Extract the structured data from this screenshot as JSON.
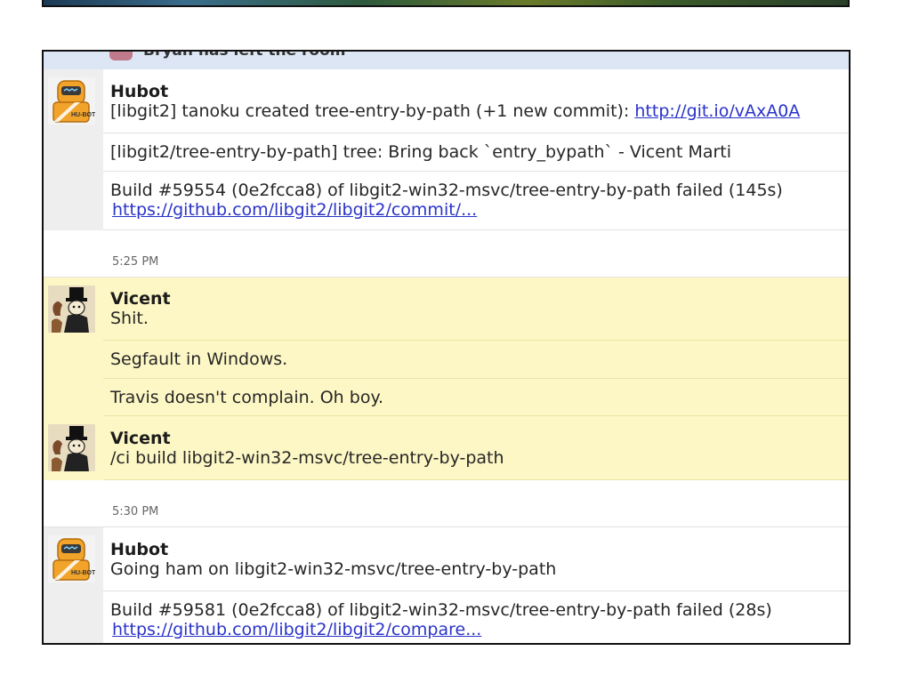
{
  "system_notice": "Bryan has left the room",
  "feed": [
    {
      "author": "Hubot",
      "messages": [
        {
          "text": "[libgit2] tanoku created tree-entry-by-path (+1 new commit): ",
          "link": "http://git.io/vAxA0A"
        },
        {
          "text": "[libgit2/tree-entry-by-path] tree: Bring back `entry_bypath` - Vicent Marti"
        },
        {
          "text": "Build #59554 (0e2fcca8) of libgit2-win32-msvc/tree-entry-by-path failed (145s)",
          "link": "https://github.com/libgit2/libgit2/commit/..."
        }
      ]
    },
    {
      "timestamp": "5:25 PM"
    },
    {
      "author": "Vicent",
      "messages": [
        {
          "text": "Shit."
        },
        {
          "text": "Segfault in Windows."
        },
        {
          "text": "Travis doesn't complain. Oh boy."
        }
      ]
    },
    {
      "author": "Vicent",
      "messages": [
        {
          "text": "/ci build libgit2-win32-msvc/tree-entry-by-path"
        }
      ]
    },
    {
      "timestamp": "5:30 PM"
    },
    {
      "author": "Hubot",
      "messages": [
        {
          "text": "Going ham on libgit2-win32-msvc/tree-entry-by-path"
        },
        {
          "text": "Build #59581 (0e2fcca8) of libgit2-win32-msvc/tree-entry-by-path failed (28s)",
          "link": "https://github.com/libgit2/libgit2/compare..."
        }
      ]
    }
  ],
  "avatars": {
    "hubot_badge": "HU-BOT",
    "hubot_icon": "robot-icon",
    "vicent_icon": "top-hat-character-icon"
  },
  "colors": {
    "user_highlight": "#fdf7c5",
    "link": "#2a33c9",
    "system_bar": "#dde6f4"
  }
}
